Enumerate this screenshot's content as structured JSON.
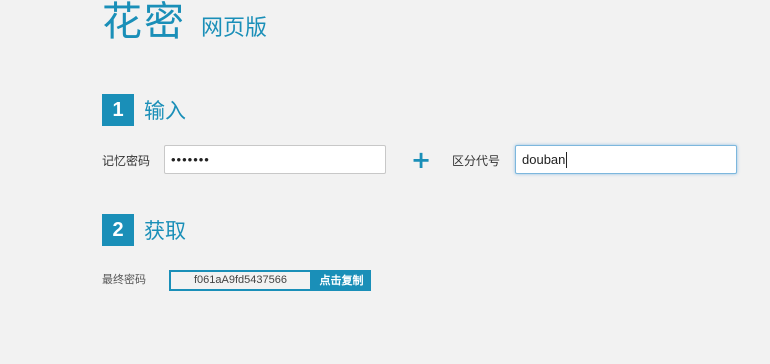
{
  "header": {
    "logo": "花密",
    "subtitle": "网页版"
  },
  "step1": {
    "number": "1",
    "title": "输入",
    "memory_label": "记忆密码",
    "memory_value": "•••••••",
    "plus_symbol": "+",
    "code_label": "区分代号",
    "code_value": "douban"
  },
  "step2": {
    "number": "2",
    "title": "获取",
    "final_label": "最终密码",
    "final_value": "f061aA9fd5437566",
    "copy_label": "点击复制"
  },
  "colors": {
    "accent": "#1a8fb8",
    "background": "#f2f2f2"
  }
}
